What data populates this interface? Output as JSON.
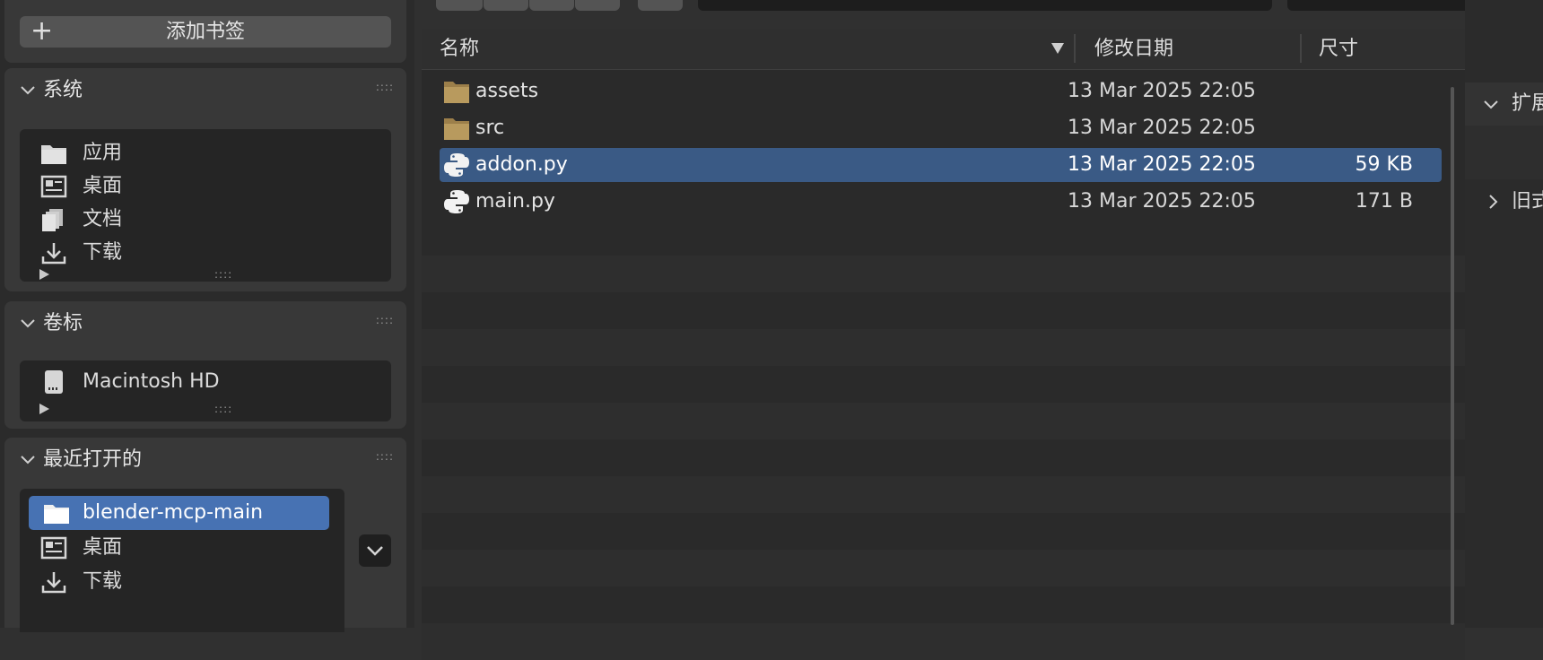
{
  "bookmarks": {
    "add_label": "添加书签"
  },
  "system": {
    "title": "系统",
    "items": [
      {
        "icon": "folder-icon",
        "label": "应用"
      },
      {
        "icon": "desktop-icon",
        "label": "桌面"
      },
      {
        "icon": "documents-icon",
        "label": "文档"
      },
      {
        "icon": "download-icon",
        "label": "下载"
      }
    ]
  },
  "volumes": {
    "title": "卷标",
    "items": [
      {
        "icon": "drive-icon",
        "label": "Macintosh HD"
      }
    ]
  },
  "recent": {
    "title": "最近打开的",
    "items": [
      {
        "icon": "folder-icon",
        "label": "blender-mcp-main",
        "selected": true
      },
      {
        "icon": "desktop-icon",
        "label": "桌面"
      },
      {
        "icon": "download-icon",
        "label": "下载"
      }
    ]
  },
  "file_list": {
    "columns": {
      "name": "名称",
      "date": "修改日期",
      "size": "尺寸"
    },
    "sort": {
      "column": "name",
      "direction": "descending"
    },
    "rows": [
      {
        "icon": "folder-icon",
        "name": "assets",
        "date": "13 Mar 2025 22:05",
        "size": ""
      },
      {
        "icon": "folder-icon",
        "name": "src",
        "date": "13 Mar 2025 22:05",
        "size": ""
      },
      {
        "icon": "python-file-icon",
        "name": "addon.py",
        "date": "13 Mar 2025 22:05",
        "size": "59 KB",
        "selected": true
      },
      {
        "icon": "python-file-icon",
        "name": "main.py",
        "date": "13 Mar 2025 22:05",
        "size": "171 B"
      }
    ]
  },
  "right_panel": {
    "sections": [
      {
        "label": "扩展",
        "expanded": true
      },
      {
        "label": "旧式",
        "expanded": false
      }
    ]
  },
  "colors": {
    "accent": "#4772b3",
    "row_selected": "#3a5a85",
    "folder": "#b89a5e",
    "background": "#303030"
  }
}
